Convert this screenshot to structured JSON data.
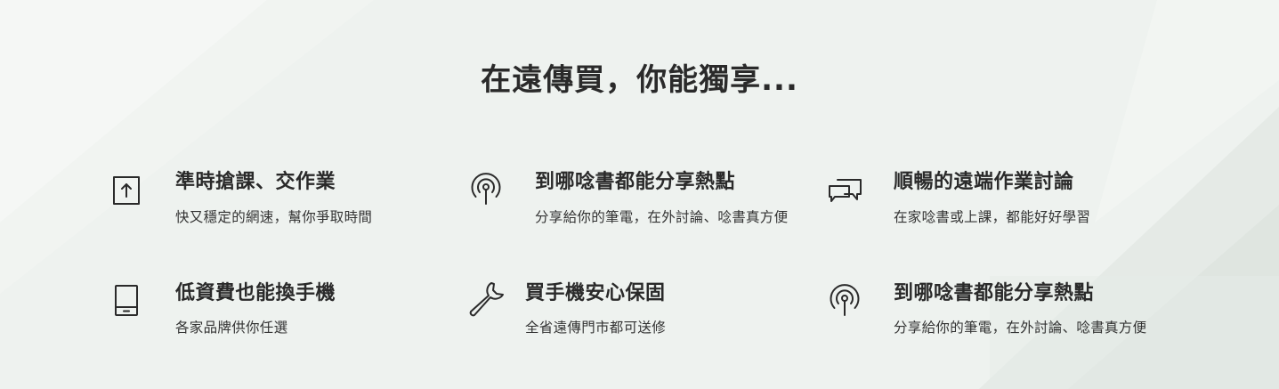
{
  "page_title": "在遠傳買，你能獨享...",
  "features": [
    {
      "title": "準時搶課、交作業",
      "desc": "快又穩定的網速，幫你爭取時間",
      "icon": "upload-box-icon"
    },
    {
      "title": "到哪唸書都能分享熱點",
      "desc": "分享給你的筆電，在外討論、唸書真方便",
      "icon": "hotspot-icon"
    },
    {
      "title": "順暢的遠端作業討論",
      "desc": "在家唸書或上課，都能好好學習",
      "icon": "chat-bubbles-icon"
    },
    {
      "title": "低資費也能換手機",
      "desc": "各家品牌供你任選",
      "icon": "tablet-icon"
    },
    {
      "title": "買手機安心保固",
      "desc": "全省遠傳門市都可送修",
      "icon": "wrench-icon"
    },
    {
      "title": "到哪唸書都能分享熱點",
      "desc": "分享給你的筆電，在外討論、唸書真方便",
      "icon": "hotspot-icon"
    }
  ]
}
